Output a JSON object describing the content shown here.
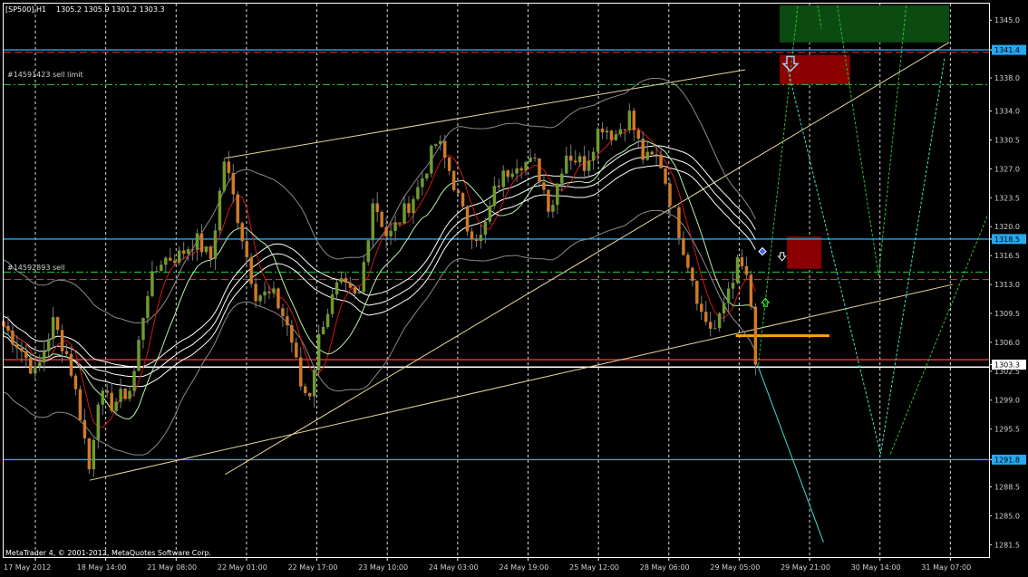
{
  "header": {
    "symbol_timeframe": "[SP500],H1",
    "ohlc": "1305.2 1305.9 1301.2 1303.3"
  },
  "copyright": "MetaTrader 4, © 2001-2012, MetaQuotes Software Corp.",
  "orders": {
    "sell_limit": "#14591423 sell limit",
    "sell": "#14592893 sell"
  },
  "colors": {
    "background": "#000000",
    "frame": "#ffffff",
    "grid": "#ffffff",
    "bull_body": "#6f9a2f",
    "bear_body": "#d07a28",
    "wick": "#7a7a7a",
    "ma_red": "#d01818",
    "ma_green": "#b8f0b0",
    "envelope_white": "#ffffff",
    "bollinger": "#8a8a8a",
    "channel": "#e8d7a0",
    "hline_blue": "#25a8f0",
    "hline_red": "#ff3030",
    "hline_green": "#40c040",
    "orange_level": "#ffa500",
    "zone_red": "#8b0000",
    "zone_green": "#0b4a10",
    "forecast_green": "#30c030",
    "forecast_cyan": "#40e0d0"
  },
  "chart_data": {
    "type": "candlestick",
    "title": "[SP500],H1",
    "ylim": [
      1280.0,
      1347.0
    ],
    "y_ticks": [
      "1345.0",
      "1341.4",
      "1338.0",
      "1334.0",
      "1330.5",
      "1327.0",
      "1323.5",
      "1320.0",
      "1318.5",
      "1316.5",
      "1313.0",
      "1309.5",
      "1306.0",
      "1303.3",
      "1302.5",
      "1299.0",
      "1295.5",
      "1291.8",
      "1288.5",
      "1285.0",
      "1281.5"
    ],
    "x_ticks": [
      "17 May 2012",
      "18 May 14:00",
      "21 May 08:00",
      "22 May 01:00",
      "22 May 17:00",
      "23 May 10:00",
      "24 May 03:00",
      "24 May 19:00",
      "25 May 12:00",
      "28 May 06:00",
      "29 May 05:00",
      "29 May 21:00",
      "30 May 14:00",
      "31 May 07:00"
    ],
    "price_markers": [
      {
        "label": "1341.4",
        "value": 1341.4,
        "color": "#25a8f0"
      },
      {
        "label": "1318.5",
        "value": 1318.5,
        "color": "#25a8f0"
      },
      {
        "label": "1303.3",
        "value": 1303.3,
        "color": "#ffffff"
      },
      {
        "label": "1291.8",
        "value": 1291.8,
        "color": "#25a8f0"
      }
    ],
    "horizontal_levels": [
      {
        "value": 1341.4,
        "style": "solid",
        "color": "#25a8f0"
      },
      {
        "value": 1341.1,
        "style": "dashed",
        "color": "#ff3030"
      },
      {
        "value": 1337.2,
        "style": "dashdot",
        "color": "#40c040"
      },
      {
        "value": 1318.5,
        "style": "solid",
        "color": "#25a8f0"
      },
      {
        "value": 1314.5,
        "style": "dashdot",
        "color": "#40c040"
      },
      {
        "value": 1313.6,
        "style": "dashed",
        "color": "#ff3030"
      },
      {
        "value": 1303.9,
        "style": "solid",
        "color": "#ff3030"
      },
      {
        "value": 1303.0,
        "style": "solid",
        "color": "#ffffff"
      },
      {
        "value": 1291.8,
        "style": "solid",
        "color": "#25a8f0"
      }
    ],
    "channel_lines": [
      {
        "from": [
          0.2248,
          1290.0
        ],
        "to": [
          0.9594,
          1342.3
        ]
      },
      {
        "from": [
          0.0873,
          1289.3
        ],
        "to": [
          0.963,
          1313.0
        ]
      },
      {
        "from": [
          0.2248,
          1328.3
        ],
        "to": [
          0.7524,
          1339.0
        ]
      }
    ],
    "key_points": [
      [
        0.0,
        1308.0
      ],
      [
        0.016,
        1305.5
      ],
      [
        0.033,
        1302.0
      ],
      [
        0.05,
        1308.5
      ],
      [
        0.066,
        1304.0
      ],
      [
        0.08,
        1296.0
      ],
      [
        0.087,
        1290.5
      ],
      [
        0.096,
        1299.5
      ],
      [
        0.11,
        1298.5
      ],
      [
        0.13,
        1300.5
      ],
      [
        0.145,
        1312.0
      ],
      [
        0.16,
        1316.0
      ],
      [
        0.178,
        1316.5
      ],
      [
        0.195,
        1318.5
      ],
      [
        0.21,
        1316.0
      ],
      [
        0.224,
        1328.2
      ],
      [
        0.24,
        1320.0
      ],
      [
        0.255,
        1312.0
      ],
      [
        0.275,
        1311.5
      ],
      [
        0.29,
        1307.5
      ],
      [
        0.302,
        1300.5
      ],
      [
        0.31,
        1299.5
      ],
      [
        0.322,
        1308.0
      ],
      [
        0.34,
        1313.0
      ],
      [
        0.36,
        1311.0
      ],
      [
        0.375,
        1323.5
      ],
      [
        0.39,
        1318.5
      ],
      [
        0.405,
        1321.5
      ],
      [
        0.42,
        1324.5
      ],
      [
        0.44,
        1330.5
      ],
      [
        0.455,
        1326.0
      ],
      [
        0.47,
        1320.0
      ],
      [
        0.485,
        1318.5
      ],
      [
        0.5,
        1325.0
      ],
      [
        0.52,
        1328.0
      ],
      [
        0.54,
        1327.5
      ],
      [
        0.555,
        1322.0
      ],
      [
        0.57,
        1329.0
      ],
      [
        0.59,
        1327.5
      ],
      [
        0.606,
        1332.5
      ],
      [
        0.62,
        1331.0
      ],
      [
        0.635,
        1333.5
      ],
      [
        0.65,
        1328.0
      ],
      [
        0.665,
        1328.5
      ],
      [
        0.675,
        1324.0
      ],
      [
        0.69,
        1317.5
      ],
      [
        0.7,
        1313.5
      ],
      [
        0.708,
        1309.5
      ],
      [
        0.716,
        1308.0
      ],
      [
        0.724,
        1307.5
      ],
      [
        0.735,
        1312.5
      ],
      [
        0.745,
        1315.5
      ],
      [
        0.755,
        1314.0
      ],
      [
        0.763,
        1303.3
      ]
    ],
    "annotations": [
      "#14591423 sell limit",
      "#14592893 sell"
    ]
  }
}
